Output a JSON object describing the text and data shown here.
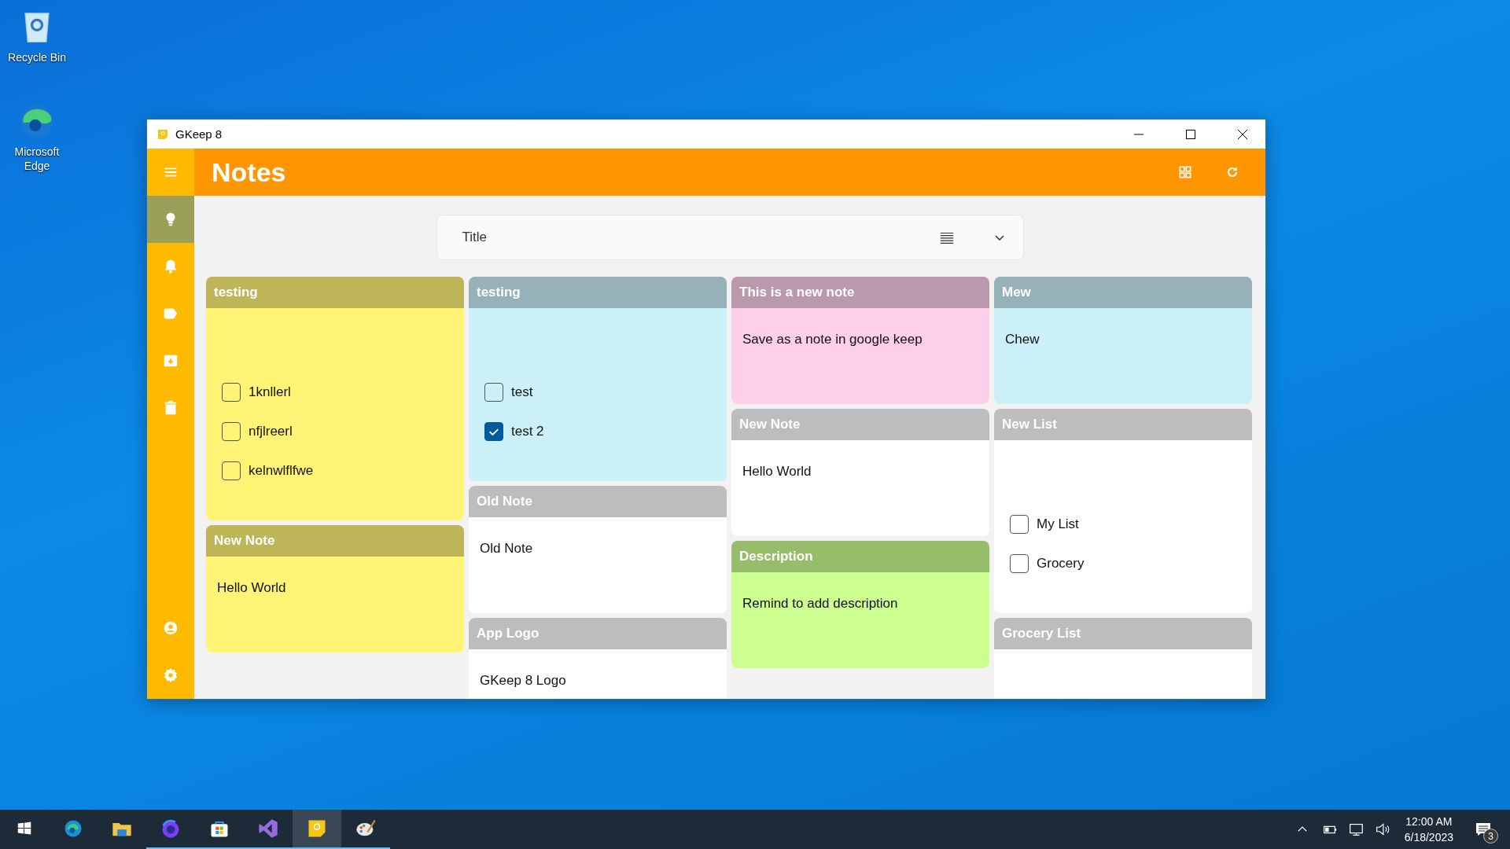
{
  "desktop_icons": [
    {
      "label": "Recycle Bin"
    },
    {
      "label": "Microsoft Edge"
    }
  ],
  "window": {
    "title": "GKeep 8"
  },
  "header": {
    "title": "Notes"
  },
  "sidebar": {
    "items": [
      {
        "selected": true
      },
      {
        "selected": false
      },
      {
        "selected": false
      },
      {
        "selected": false
      },
      {
        "selected": false
      }
    ]
  },
  "sort_box": {
    "value": "Title"
  },
  "columns": [
    [
      {
        "title": "testing",
        "color": "#fff475",
        "kind": "list",
        "items": [
          {
            "label": "1knllerl",
            "checked": false
          },
          {
            "label": "nfjlreerl",
            "checked": false
          },
          {
            "label": "kelnwlflfwe",
            "checked": false
          }
        ]
      },
      {
        "title": "New Note",
        "color": "#fff475",
        "kind": "text",
        "text": "Hello World"
      }
    ],
    [
      {
        "title": "testing",
        "color": "#cbf0f8",
        "kind": "list",
        "items": [
          {
            "label": "test",
            "checked": false
          },
          {
            "label": "test 2",
            "checked": true
          }
        ]
      },
      {
        "title": "Old Note",
        "color": "#ffffff",
        "kind": "text",
        "text": "Old Note"
      },
      {
        "title": "App Logo",
        "color": "#ffffff",
        "kind": "text",
        "text": "GKeep 8 Logo"
      }
    ],
    [
      {
        "title": "This is a new note",
        "color": "#fdcfe8",
        "kind": "text",
        "text": "Save as a note in google keep"
      },
      {
        "title": "New Note",
        "color": "#ffffff",
        "kind": "text",
        "text": "Hello World"
      },
      {
        "title": "Description",
        "color": "#ccff90",
        "kind": "text",
        "text": "Remind to add description"
      }
    ],
    [
      {
        "title": "Mew",
        "color": "#cbf0f8",
        "kind": "text",
        "text": "Chew"
      },
      {
        "title": "New List",
        "color": "#ffffff",
        "kind": "list",
        "items": [
          {
            "label": "My List",
            "checked": false
          },
          {
            "label": "Grocery",
            "checked": false
          }
        ]
      },
      {
        "title": "Grocery List",
        "color": "#ffffff",
        "kind": "text"
      }
    ]
  ],
  "taskbar": {
    "apps": [
      {
        "running": false,
        "active": false
      },
      {
        "running": false,
        "active": false
      },
      {
        "running": true,
        "active": false
      },
      {
        "running": true,
        "active": false
      },
      {
        "running": true,
        "active": false
      },
      {
        "running": true,
        "active": true
      },
      {
        "running": true,
        "active": false
      }
    ],
    "clock": {
      "time": "12:00 AM",
      "date": "6/18/2023"
    },
    "notification_count": "3"
  }
}
